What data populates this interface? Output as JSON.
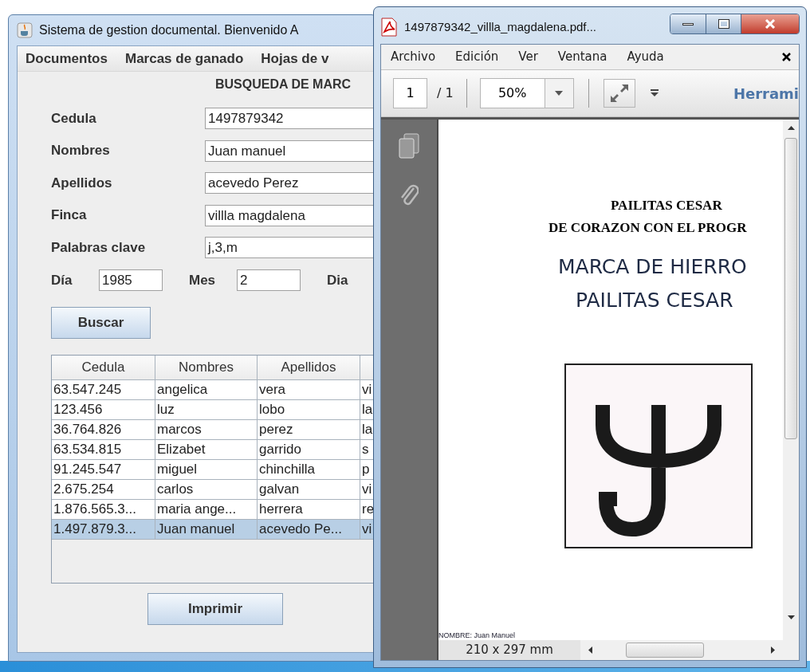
{
  "main_window": {
    "title": "Sistema de gestion documental. Bienvenido A",
    "menu": [
      "Documentos",
      "Marcas de ganado",
      "Hojas de v"
    ],
    "heading": "BUSQUEDA DE MARC",
    "fields": [
      {
        "label": "Cedula",
        "value": "1497879342"
      },
      {
        "label": "Nombres",
        "value": "Juan manuel"
      },
      {
        "label": "Apellidos",
        "value": "acevedo Perez"
      },
      {
        "label": "Finca",
        "value": "villla magdalena"
      },
      {
        "label": "Palabras clave",
        "value": "j,3,m"
      }
    ],
    "date_fields": [
      {
        "label": "Día",
        "value": "1985"
      },
      {
        "label": "Mes",
        "value": "2"
      },
      {
        "label": "Dia"
      }
    ],
    "search_button": "Buscar",
    "table": {
      "columns": [
        "Cedula",
        "Nombres",
        "Apellidos"
      ],
      "rows": [
        {
          "cells": [
            "63.547.245",
            "angelica",
            "vera",
            "vi"
          ],
          "selected": false
        },
        {
          "cells": [
            "123.456",
            "luz",
            "lobo",
            "la"
          ],
          "selected": false
        },
        {
          "cells": [
            "36.764.826",
            "marcos",
            "perez",
            "la"
          ],
          "selected": false
        },
        {
          "cells": [
            "63.534.815",
            "Elizabet",
            "garrido",
            "s"
          ],
          "selected": false
        },
        {
          "cells": [
            "91.245.547",
            "miguel",
            "chinchilla",
            "p"
          ],
          "selected": false
        },
        {
          "cells": [
            "2.675.254",
            "carlos",
            "galvan",
            "vi"
          ],
          "selected": false
        },
        {
          "cells": [
            "1.876.565.3...",
            "maria ange...",
            "herrera",
            "re"
          ],
          "selected": false
        },
        {
          "cells": [
            "1.497.879.3...",
            "Juan manuel",
            "acevedo Pe...",
            "vi"
          ],
          "selected": true
        }
      ]
    },
    "print_button": "Imprimir"
  },
  "pdf_window": {
    "title": "1497879342_villla_magdalena.pdf...",
    "menu": [
      "Archivo",
      "Edición",
      "Ver",
      "Ventana",
      "Ayuda"
    ],
    "toolbar": {
      "page": "1",
      "page_total": "/ 1",
      "zoom": "50%",
      "tools": "Herrami"
    },
    "document": {
      "lines": [
        {
          "kind": "banner",
          "text": "PAILITAS CESAR"
        },
        {
          "kind": "banner",
          "text": "DE CORAZON CON EL PROGR"
        },
        {
          "kind": "title",
          "text": "MARCA DE HIERRO"
        },
        {
          "kind": "title",
          "text": "PAILITAS CESAR"
        }
      ],
      "footer": "NOMBRE: Juan Manuel"
    },
    "page_size": "210 x 297 mm"
  }
}
